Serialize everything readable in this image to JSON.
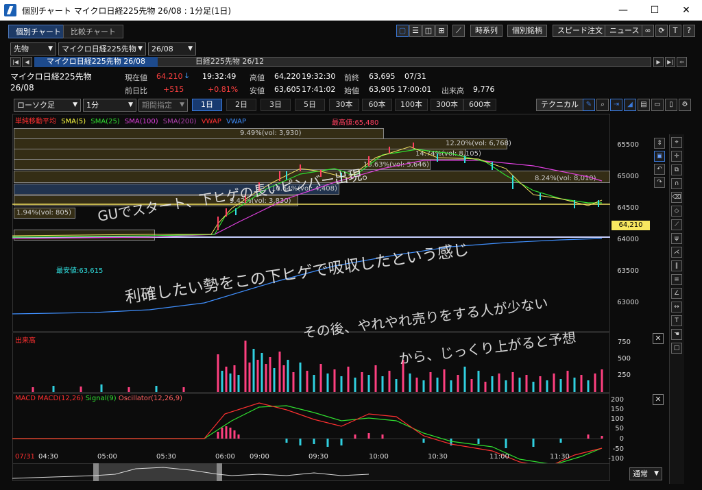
{
  "window": {
    "title": "個別チャート マイクロ日経225先物 26/08 : 1分足(1日)",
    "min": "—",
    "max": "☐",
    "close": "✕"
  },
  "tabs": [
    "個別チャート",
    "比較チャート"
  ],
  "toolbar": {
    "b1": "時系列",
    "b2": "個別銘柄",
    "b3": "スピード注文",
    "b4": "ニュース",
    "t": "T",
    "q": "?"
  },
  "selectors": {
    "market": "先物",
    "product": "マイクロ日経225先物",
    "contract": "26/08"
  },
  "contracts": {
    "c1": "マイクロ日経225先物 26/08",
    "c2": "日経225先物 26/12"
  },
  "quote": {
    "name": "マイクロ日経225先物",
    "contract": "26/08",
    "current_label": "現在値",
    "current": "64,210",
    "current_arrow": "↓",
    "current_time": "19:32:49",
    "high_label": "高値",
    "high": "64,220",
    "high_time": "19:32:30",
    "prev_close_label": "前終",
    "prev_close": "63,695",
    "prev_date": "07/31",
    "change_label": "前日比",
    "change": "+515",
    "change_pct": "+0.81%",
    "low_label": "安値",
    "low": "63,605",
    "low_time": "17:41:02",
    "open_label": "始値",
    "open": "63,905",
    "open_time": "17:00:01",
    "volume_label": "出来高",
    "volume": "9,776"
  },
  "controls": {
    "candle": "ローソク足",
    "interval": "1分",
    "period": "期間指定",
    "technical": "テクニカル"
  },
  "periods": [
    "1日",
    "2日",
    "3日",
    "5日",
    "30本",
    "60本",
    "100本",
    "300本",
    "600本"
  ],
  "legend": {
    "main": "単純移動平均",
    "sma5": "SMA(5)",
    "sma25": "SMA(25)",
    "sma100": "SMA(100)",
    "sma200": "SMA(200)",
    "vwap": "VWAP",
    "vwap2": "VWAP",
    "colors": {
      "main": "#ff3030",
      "sma5": "#ffff40",
      "sma25": "#30e030",
      "sma100": "#e040e0",
      "sma200": "#b040b0",
      "vwap": "#ff3030",
      "vwap2": "#4090ff"
    }
  },
  "price_axis": [
    "65500",
    "65000",
    "64500",
    "64000",
    "63500",
    "63000"
  ],
  "price_tag": "64,210",
  "markers": {
    "high": "最高値:65,480",
    "low": "最安値:63,615"
  },
  "bands": [
    "9.49%(vol: 3,930)",
    "12.20%(vol: 6,768)",
    "14.74%(vol: 8,105)",
    "13.63%(vol: 5,646)",
    "8.24%(vol: 8,010)",
    "10.64%(vol: 4,408)",
    "9.42%(vol: 3,830)",
    "1.94%(vol: 805)"
  ],
  "volume_panel": {
    "label": "出来高",
    "axis": [
      "750",
      "500",
      "250"
    ]
  },
  "macd_panel": {
    "label": "MACD",
    "macd": "MACD(12,26)",
    "signal": "Signal(9)",
    "osc": "Oscillator(12,26,9)",
    "axis": [
      "200",
      "150",
      "100",
      "50",
      "0",
      "-50",
      "-100"
    ]
  },
  "time_axis": [
    "07/31",
    "04:30",
    "05:00",
    "05:30",
    "06:00",
    "09:00",
    "09:30",
    "10:00",
    "10:30",
    "11:00",
    "11:30"
  ],
  "scale_select": "通常",
  "annotations": [
    "GUでスタート、下ヒゲの長いピンバー出現。",
    "利確したい勢をこの下ヒゲで吸収したという感じ",
    "その後、やれやれ売りをする人が少ない",
    "から、じっくり上がると予想"
  ]
}
